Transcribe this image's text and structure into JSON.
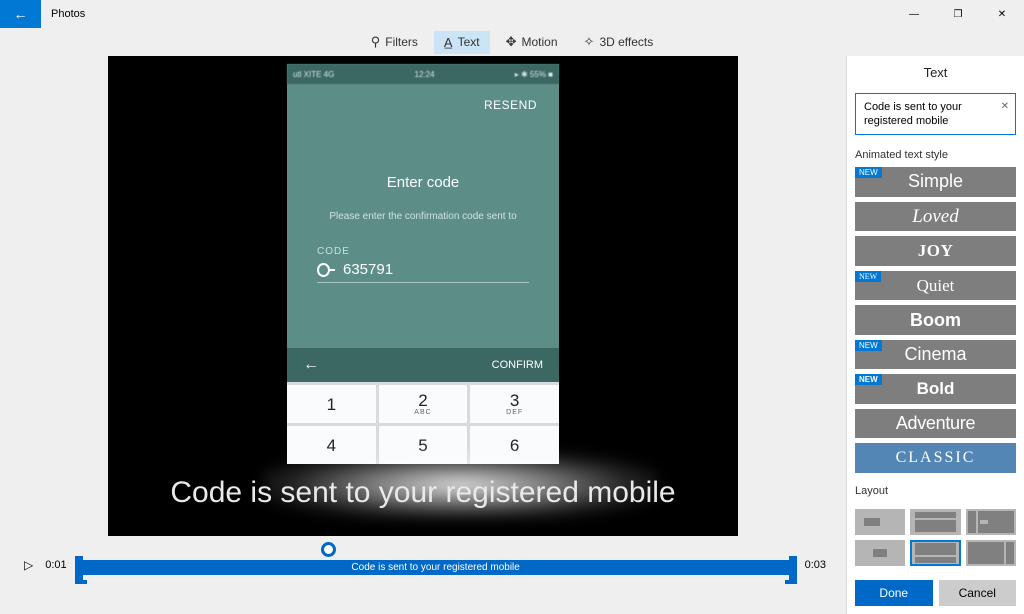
{
  "app": {
    "title": "Photos"
  },
  "window_controls": {
    "minimize": "—",
    "maximize": "❐",
    "close": "✕"
  },
  "toolbar": {
    "filters": "Filters",
    "text": "Text",
    "motion": "Motion",
    "effects3d": "3D effects"
  },
  "preview": {
    "status_left": "utl XITE  4G",
    "status_time": "12:24",
    "status_right": "▸ ✱ 55% ■",
    "resend": "RESEND",
    "enter_code": "Enter code",
    "instruction": "Please enter the confirmation code sent to",
    "code_label": "CODE",
    "code_value": "635791",
    "back_arrow": "←",
    "confirm": "CONFIRM",
    "keypad": [
      {
        "n": "1",
        "s": ""
      },
      {
        "n": "2",
        "s": "ABC"
      },
      {
        "n": "3",
        "s": "DEF"
      },
      {
        "n": "4",
        "s": ""
      },
      {
        "n": "5",
        "s": ""
      },
      {
        "n": "6",
        "s": ""
      }
    ],
    "overlay_text": "Code is sent to your registered mobile"
  },
  "timeline": {
    "start": "0:01",
    "end": "0:03",
    "clip_label": "Code is sent to your registered mobile"
  },
  "sidebar": {
    "title": "Text",
    "input_value": "Code is sent to your registered mobile",
    "style_label": "Animated text style",
    "new_badge": "NEW",
    "styles": {
      "simple": "Simple",
      "loved": "Loved",
      "joy": "JOY",
      "quiet": "Quiet",
      "boom": "Boom",
      "cinema": "Cinema",
      "bold": "Bold",
      "adventure": "Adventure",
      "classic": "CLASSIC"
    },
    "layout_label": "Layout",
    "done": "Done",
    "cancel": "Cancel"
  }
}
